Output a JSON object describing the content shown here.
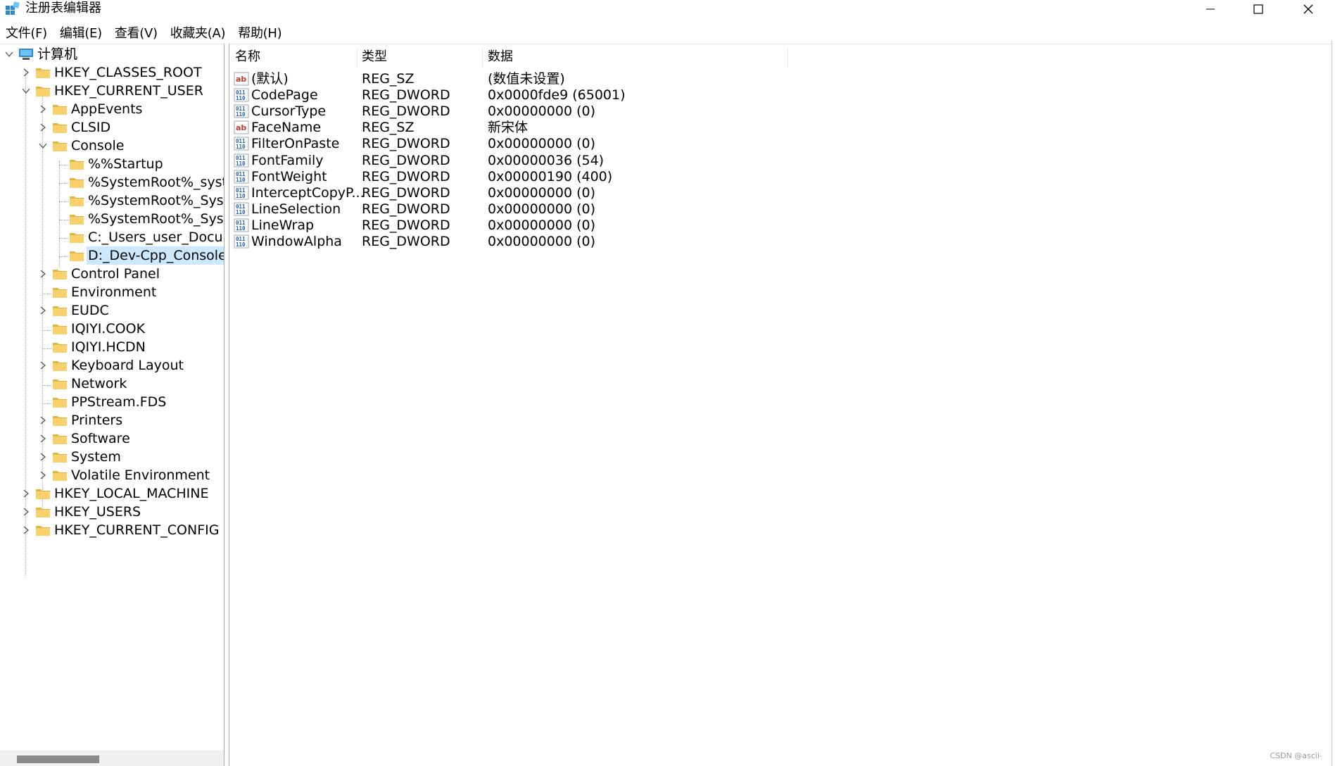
{
  "window": {
    "title": "注册表编辑器",
    "app_icon": "registry-editor-icon",
    "controls": [
      "minimize-icon",
      "maximize-icon",
      "close-icon"
    ]
  },
  "menu": {
    "items": [
      "文件(F)",
      "编辑(E)",
      "查看(V)",
      "收藏夹(A)",
      "帮助(H)"
    ]
  },
  "tree": {
    "root": "计算机",
    "hives": {
      "classes_root": "HKEY_CLASSES_ROOT",
      "current_user": "HKEY_CURRENT_USER",
      "local_machine": "HKEY_LOCAL_MACHINE",
      "users": "HKEY_USERS",
      "current_config": "HKEY_CURRENT_CONFIG"
    },
    "current_user_children": [
      "AppEvents",
      "CLSID",
      "Console",
      "Control Panel",
      "Environment",
      "EUDC",
      "IQIYI.COOK",
      "IQIYI.HCDN",
      "Keyboard Layout",
      "Network",
      "PPStream.FDS",
      "Printers",
      "Software",
      "System",
      "Volatile Environment"
    ],
    "console_children": [
      "%%Startup",
      "%SystemRoot%_syster",
      "%SystemRoot%_Syster",
      "%SystemRoot%_SysWo",
      "C:_Users_user_Docume",
      "D:_Dev-Cpp_ConsoleP"
    ],
    "selected": "D:_Dev-Cpp_ConsoleP"
  },
  "list": {
    "headers": {
      "name": "名称",
      "type": "类型",
      "data": "数据"
    },
    "rows": [
      {
        "icon": "string-value-icon",
        "name": "(默认)",
        "type": "REG_SZ",
        "data": "(数值未设置)"
      },
      {
        "icon": "dword-value-icon",
        "name": "CodePage",
        "type": "REG_DWORD",
        "data": "0x0000fde9 (65001)"
      },
      {
        "icon": "dword-value-icon",
        "name": "CursorType",
        "type": "REG_DWORD",
        "data": "0x00000000 (0)"
      },
      {
        "icon": "string-value-icon",
        "name": "FaceName",
        "type": "REG_SZ",
        "data": "新宋体"
      },
      {
        "icon": "dword-value-icon",
        "name": "FilterOnPaste",
        "type": "REG_DWORD",
        "data": "0x00000000 (0)"
      },
      {
        "icon": "dword-value-icon",
        "name": "FontFamily",
        "type": "REG_DWORD",
        "data": "0x00000036 (54)"
      },
      {
        "icon": "dword-value-icon",
        "name": "FontWeight",
        "type": "REG_DWORD",
        "data": "0x00000190 (400)"
      },
      {
        "icon": "dword-value-icon",
        "name": "InterceptCopyP...",
        "type": "REG_DWORD",
        "data": "0x00000000 (0)"
      },
      {
        "icon": "dword-value-icon",
        "name": "LineSelection",
        "type": "REG_DWORD",
        "data": "0x00000000 (0)"
      },
      {
        "icon": "dword-value-icon",
        "name": "LineWrap",
        "type": "REG_DWORD",
        "data": "0x00000000 (0)"
      },
      {
        "icon": "dword-value-icon",
        "name": "WindowAlpha",
        "type": "REG_DWORD",
        "data": "0x00000000 (0)"
      }
    ]
  },
  "watermark": "CSDN @ascii-",
  "colors": {
    "selection": "#cce8ff",
    "folder": "#f6c64c",
    "computer": "#2b88d8"
  }
}
